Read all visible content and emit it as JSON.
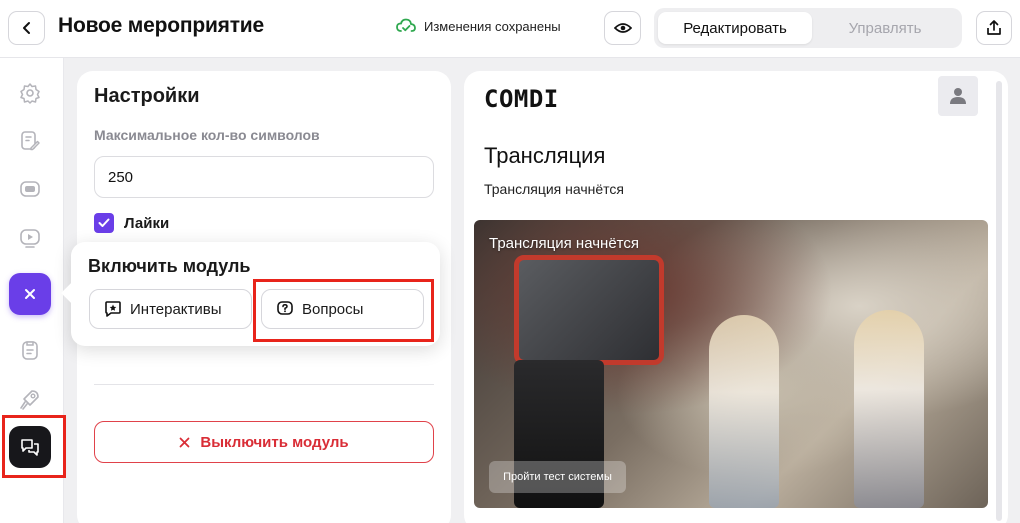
{
  "header": {
    "title": "Новое мероприятие",
    "save_status": "Изменения сохранены",
    "tabs": [
      {
        "label": "Редактировать",
        "active": true
      },
      {
        "label": "Управлять",
        "active": false
      }
    ]
  },
  "sidebar": {
    "icons": [
      "gear-icon",
      "edit-document-icon",
      "chat-box-icon",
      "play-icon",
      "clipboard-icon",
      "rocket-icon",
      "chat-bubbles-icon"
    ],
    "accent_color": "#6a3ee8"
  },
  "settings": {
    "title": "Настройки",
    "max_chars_label": "Максимальное кол-во символов",
    "max_chars_value": "250",
    "likes_label": "Лайки",
    "disable_module_label": "Выключить модуль"
  },
  "popup": {
    "title": "Включить модуль",
    "options": [
      {
        "label": "Интерактивы",
        "icon": "star-chat-icon"
      },
      {
        "label": "Вопросы",
        "icon": "question-chat-icon"
      }
    ]
  },
  "preview": {
    "brand": "COMDI",
    "heading": "Трансляция",
    "subtitle": "Трансляция начнётся",
    "video_title": "Трансляция начнётся",
    "test_button": "Пройти тест системы"
  },
  "colors": {
    "accent": "#6a3ee8",
    "danger": "#d92d36",
    "highlight": "#e8241b",
    "saved": "#2fa84f"
  }
}
